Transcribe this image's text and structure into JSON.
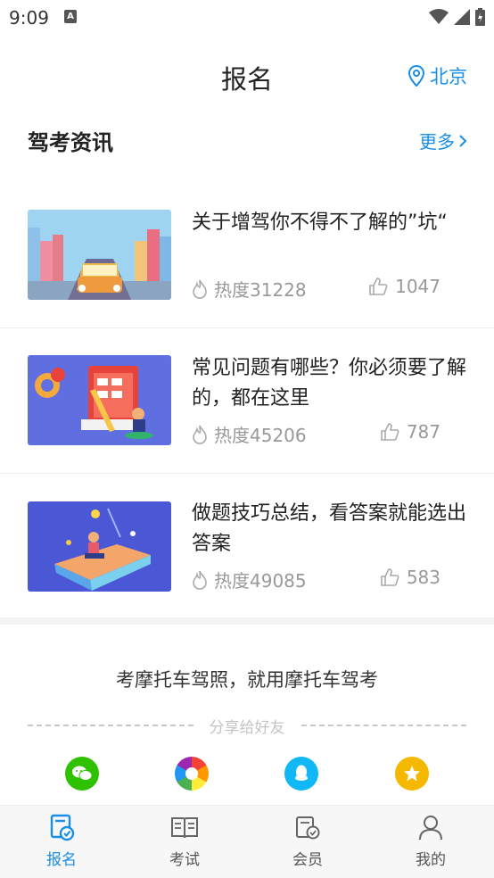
{
  "status_bar": {
    "time": "9:09",
    "notification_letter": "A"
  },
  "header": {
    "title": "报名",
    "location": "北京"
  },
  "news_section": {
    "title": "驾考资讯",
    "more_label": "更多"
  },
  "news": [
    {
      "title": "关于增驾你不得不了解的”坑“",
      "heat": "热度31228",
      "likes": "1047"
    },
    {
      "title": "常见问题有哪些？你必须要了解的，都在这里",
      "heat": "热度45206",
      "likes": "787"
    },
    {
      "title": "做题技巧总结，看答案就能选出答案",
      "heat": "热度49085",
      "likes": "583"
    }
  ],
  "share": {
    "slogan": "考摩托车驾照，就用摩托车驾考",
    "label": "分享给好友",
    "icons": [
      "wechat-icon",
      "moments-icon",
      "qq-icon",
      "qzone-icon"
    ]
  },
  "bottom_nav": [
    {
      "label": "报名",
      "icon": "signup-icon",
      "active": true
    },
    {
      "label": "考试",
      "icon": "book-icon",
      "active": false
    },
    {
      "label": "会员",
      "icon": "member-icon",
      "active": false
    },
    {
      "label": "我的",
      "icon": "profile-icon",
      "active": false
    }
  ],
  "colors": {
    "accent": "#1a8ee6",
    "muted": "#999999",
    "wechat": "#2dc100",
    "qq": "#12b7f5",
    "qzone": "#f5b800"
  }
}
